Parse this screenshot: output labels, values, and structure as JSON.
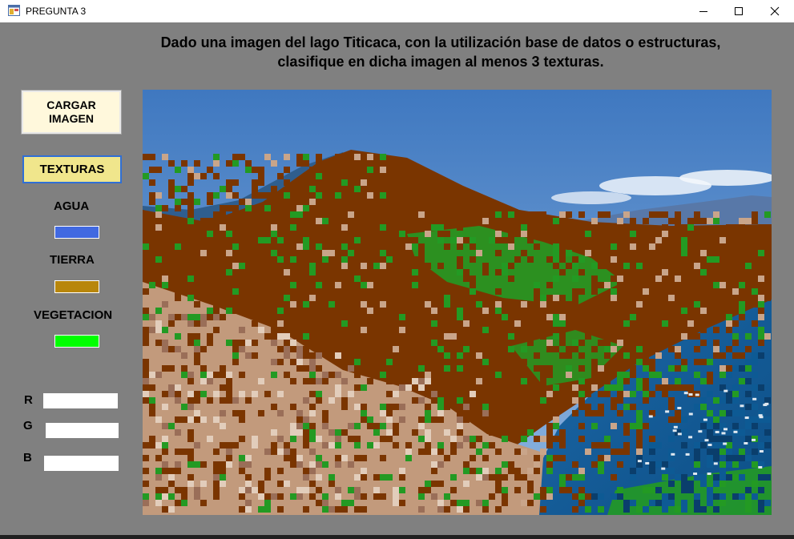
{
  "window": {
    "title": "PREGUNTA 3",
    "controls": {
      "minimize": "minimize-icon",
      "maximize": "maximize-icon",
      "close": "close-icon"
    }
  },
  "heading": {
    "line1": "Dado una imagen del lago Titicaca, con la utilización base de datos o estructuras,",
    "line2": "clasifique en dicha imagen al menos 3 texturas."
  },
  "buttons": {
    "load_line1": "CARGAR",
    "load_line2": "IMAGEN",
    "textures": "TEXTURAS"
  },
  "legend": [
    {
      "label": "AGUA",
      "color": "#4169e1"
    },
    {
      "label": "TIERRA",
      "color": "#b8860b"
    },
    {
      "label": "VEGETACION",
      "color": "#00ff00"
    }
  ],
  "rgb": {
    "r_label": "R",
    "r_value": "",
    "g_label": "G",
    "g_value": "",
    "b_label": "B",
    "b_value": ""
  },
  "image": {
    "description_icon": "classified-lake-image",
    "palette": {
      "sky": "#5b8fcb",
      "water": "#0d5a94",
      "earth": "#7a3500",
      "vegetation": "#239a23",
      "city": "#c9a58a"
    }
  }
}
